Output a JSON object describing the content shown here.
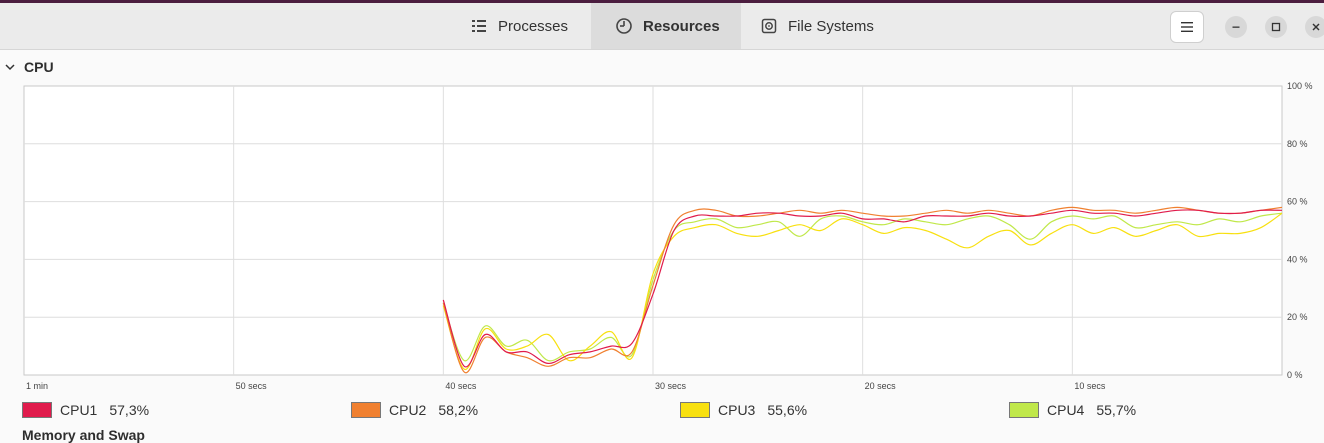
{
  "tabs": {
    "processes": "Processes",
    "resources": "Resources",
    "filesystems": "File Systems"
  },
  "section": {
    "title": "CPU"
  },
  "next_section": {
    "title": "Memory and Swap"
  },
  "chart_data": {
    "type": "line",
    "x_tick_labels": [
      "1 min",
      "50 secs",
      "40 secs",
      "30 secs",
      "20 secs",
      "10 secs"
    ],
    "y_tick_labels": [
      "100 %",
      "80 %",
      "60 %",
      "40 %",
      "20 %",
      "0 %"
    ],
    "ylim": [
      0,
      100
    ],
    "x_seconds_ago": [
      40,
      39,
      38,
      37,
      36,
      35,
      34,
      33,
      32,
      31,
      30,
      29,
      28,
      27,
      26,
      25,
      24,
      23,
      22,
      21,
      20,
      19,
      18,
      17,
      16,
      15,
      14,
      13,
      12,
      11,
      10,
      9,
      8,
      7,
      6,
      5,
      4,
      3,
      2,
      1,
      0
    ],
    "grid": true,
    "series": [
      {
        "name": "CPU1",
        "color": "#e01b4c",
        "values": [
          26,
          3,
          14,
          8,
          8,
          4,
          7,
          8,
          10,
          11,
          28,
          50,
          55,
          55,
          55,
          56,
          56,
          55,
          55,
          56,
          54,
          54,
          53,
          55,
          55,
          55,
          56,
          55,
          55,
          56,
          57,
          56,
          56,
          55,
          56,
          57,
          57,
          56,
          56,
          57,
          57
        ]
      },
      {
        "name": "CPU2",
        "color": "#f08030",
        "values": [
          25,
          1,
          13,
          8,
          6,
          3,
          6,
          6,
          9,
          8,
          31,
          52,
          57,
          57,
          55,
          55,
          56,
          57,
          56,
          57,
          56,
          55,
          55,
          56,
          57,
          56,
          57,
          56,
          55,
          57,
          58,
          57,
          57,
          56,
          57,
          58,
          57,
          56,
          56,
          57,
          58
        ]
      },
      {
        "name": "CPU3",
        "color": "#f8e010",
        "values": [
          24,
          2,
          16,
          9,
          10,
          14,
          5,
          10,
          15,
          6,
          35,
          48,
          51,
          52,
          49,
          48,
          50,
          52,
          50,
          54,
          52,
          49,
          51,
          50,
          47,
          44,
          48,
          50,
          45,
          49,
          52,
          49,
          51,
          48,
          50,
          52,
          48,
          49,
          49,
          51,
          56
        ]
      },
      {
        "name": "CPU4",
        "color": "#c0e84a",
        "values": [
          25,
          5,
          17,
          10,
          12,
          5,
          8,
          9,
          13,
          7,
          33,
          50,
          53,
          54,
          51,
          52,
          53,
          48,
          54,
          55,
          53,
          52,
          54,
          53,
          52,
          54,
          55,
          52,
          47,
          53,
          55,
          54,
          55,
          51,
          52,
          53,
          52,
          54,
          53,
          55,
          56
        ]
      }
    ]
  },
  "legend": [
    {
      "name": "CPU1",
      "value": "57,3%",
      "color": "#e01b4c"
    },
    {
      "name": "CPU2",
      "value": "58,2%",
      "color": "#f08030"
    },
    {
      "name": "CPU3",
      "value": "55,6%",
      "color": "#f8e010"
    },
    {
      "name": "CPU4",
      "value": "55,7%",
      "color": "#c0e84a"
    }
  ]
}
